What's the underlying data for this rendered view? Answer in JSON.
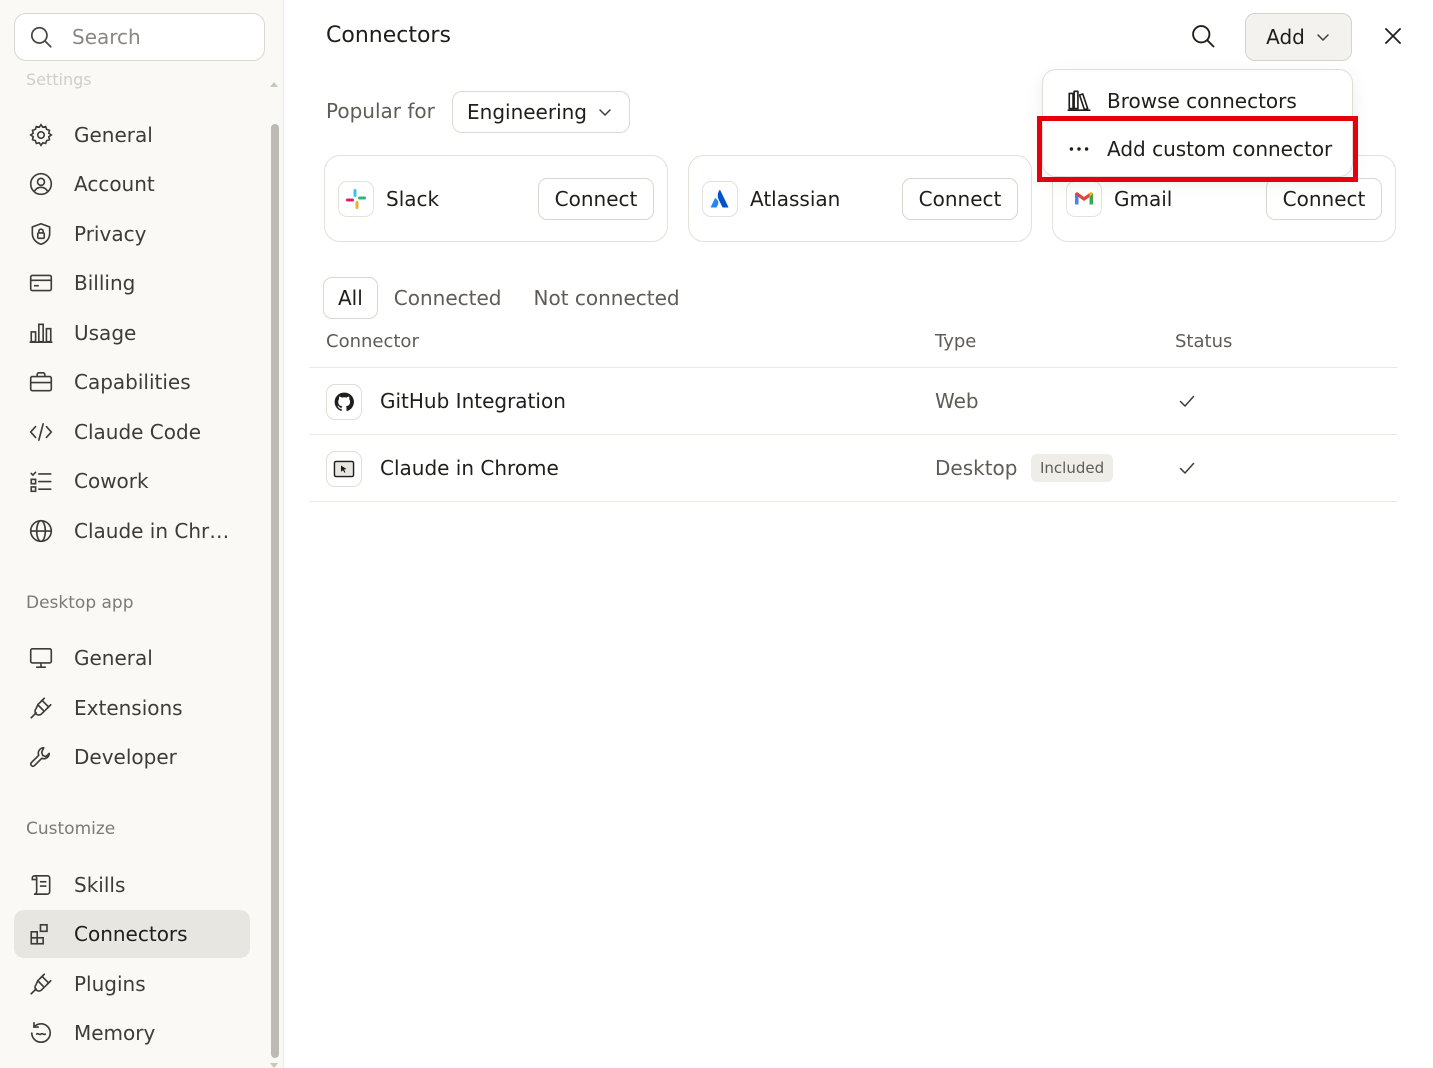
{
  "sidebar": {
    "search_placeholder": "Search",
    "faded_heading": "Settings",
    "settings_items": [
      {
        "label": "General",
        "icon": "gear-icon"
      },
      {
        "label": "Account",
        "icon": "user-circle-icon"
      },
      {
        "label": "Privacy",
        "icon": "shield-lock-icon"
      },
      {
        "label": "Billing",
        "icon": "credit-card-icon"
      },
      {
        "label": "Usage",
        "icon": "bar-chart-icon"
      },
      {
        "label": "Capabilities",
        "icon": "briefcase-icon"
      },
      {
        "label": "Claude Code",
        "icon": "code-icon"
      },
      {
        "label": "Cowork",
        "icon": "checklist-icon"
      },
      {
        "label": "Claude in Chr…",
        "icon": "globe-icon"
      }
    ],
    "desktop_section": "Desktop app",
    "desktop_items": [
      {
        "label": "General",
        "icon": "monitor-icon"
      },
      {
        "label": "Extensions",
        "icon": "plug-icon"
      },
      {
        "label": "Developer",
        "icon": "wrench-icon"
      }
    ],
    "customize_section": "Customize",
    "customize_items": [
      {
        "label": "Skills",
        "icon": "scroll-icon"
      },
      {
        "label": "Connectors",
        "icon": "grid-plus-icon",
        "active": true
      },
      {
        "label": "Plugins",
        "icon": "plug-icon"
      },
      {
        "label": "Memory",
        "icon": "history-icon"
      }
    ]
  },
  "header": {
    "title": "Connectors",
    "add_label": "Add"
  },
  "popular": {
    "label": "Popular for",
    "selected": "Engineering"
  },
  "cards": [
    {
      "name": "Slack",
      "button": "Connect"
    },
    {
      "name": "Atlassian",
      "button": "Connect"
    },
    {
      "name": "Gmail",
      "button": "Connect"
    }
  ],
  "tabs": [
    "All",
    "Connected",
    "Not connected"
  ],
  "table": {
    "headers": [
      "Connector",
      "Type",
      "Status"
    ],
    "rows": [
      {
        "name": "GitHub Integration",
        "type": "Web",
        "badge": "",
        "status": "connected"
      },
      {
        "name": "Claude in Chrome",
        "type": "Desktop",
        "badge": "Included",
        "status": "connected"
      }
    ]
  },
  "menu": {
    "items": [
      {
        "label": "Browse connectors",
        "icon": "library-icon"
      },
      {
        "label": "Add custom connector",
        "icon": "more-horizontal-icon"
      }
    ]
  },
  "colors": {
    "highlight": "#e5000e",
    "active_nav_bg": "#e8e6e1"
  }
}
